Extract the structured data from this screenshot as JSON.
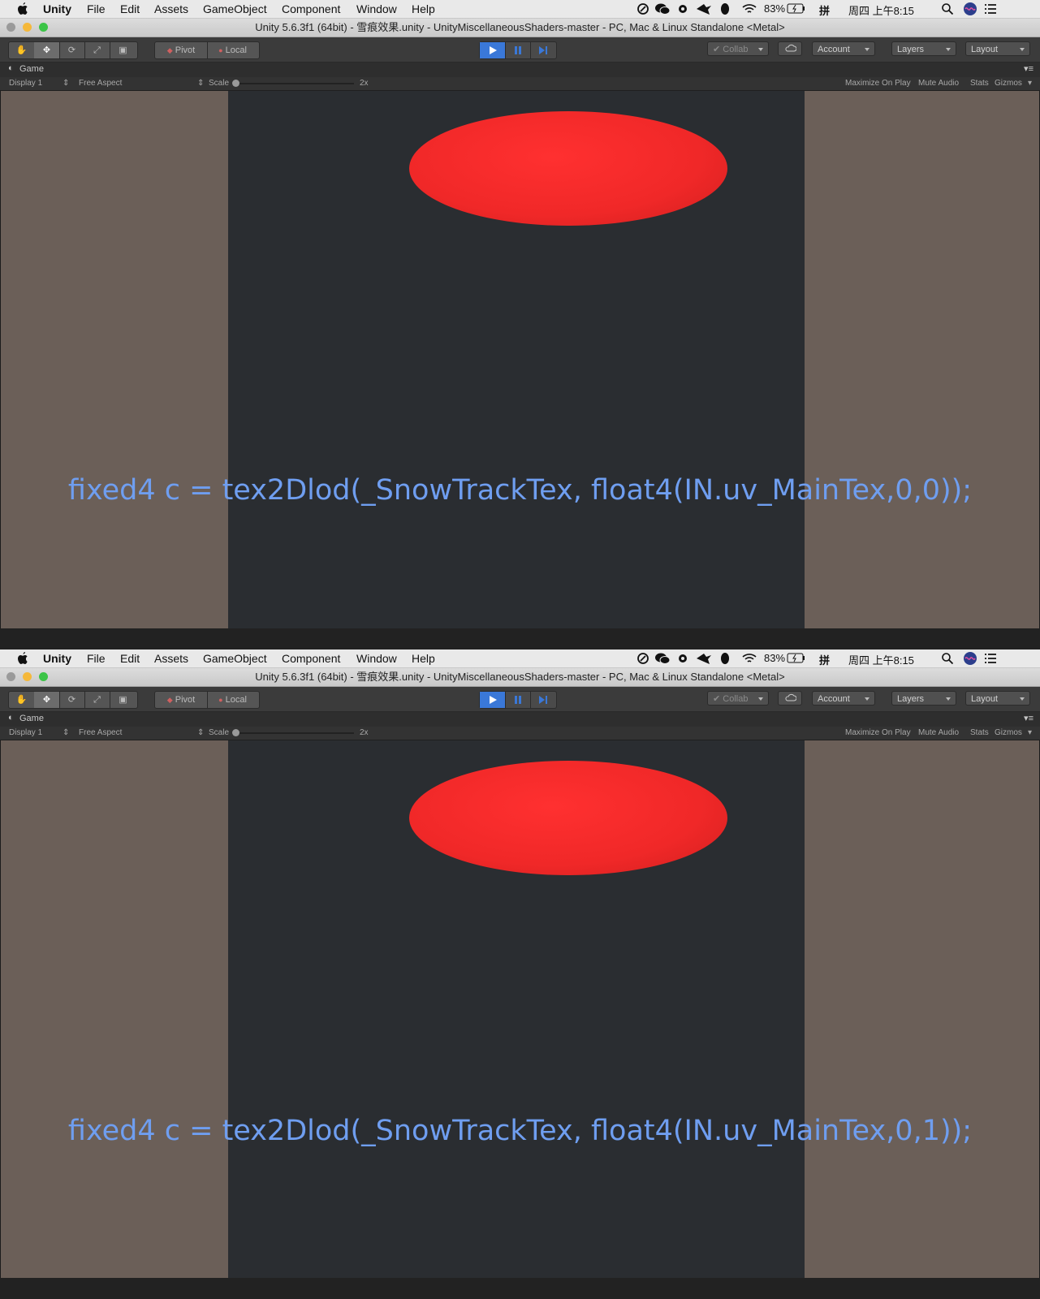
{
  "screenshots": [
    {
      "menubar": {
        "apple": "apple-logo",
        "app_name": "Unity",
        "items": [
          "File",
          "Edit",
          "Assets",
          "GameObject",
          "Component",
          "Window",
          "Help"
        ],
        "status": {
          "battery": "83%",
          "ime": "拼",
          "clock": "周四 上午8:15"
        }
      },
      "window_title": "Unity 5.6.3f1 (64bit) - 雪痕效果.unity - UnityMiscellaneousShaders-master - PC, Mac & Linux Standalone <Metal>",
      "toolbar": {
        "pivot": "Pivot",
        "local": "Local",
        "collab": "Collab",
        "account": "Account",
        "layers": "Layers",
        "layout": "Layout"
      },
      "game_tab": {
        "title": "Game",
        "display": "Display 1",
        "aspect": "Free Aspect",
        "scale_label": "Scale",
        "scale_value": "2x",
        "maximize": "Maximize On Play",
        "mute": "Mute Audio",
        "stats": "Stats",
        "gizmos": "Gizmos"
      },
      "caption": "fixed4 c = tex2Dlod(_SnowTrackTex, float4(IN.uv_MainTex,0,0));"
    },
    {
      "menubar": {
        "apple": "apple-logo",
        "app_name": "Unity",
        "items": [
          "File",
          "Edit",
          "Assets",
          "GameObject",
          "Component",
          "Window",
          "Help"
        ],
        "status": {
          "battery": "83%",
          "ime": "拼",
          "clock": "周四 上午8:15"
        }
      },
      "window_title": "Unity 5.6.3f1 (64bit) - 雪痕效果.unity - UnityMiscellaneousShaders-master - PC, Mac & Linux Standalone <Metal>",
      "toolbar": {
        "pivot": "Pivot",
        "local": "Local",
        "collab": "Collab",
        "account": "Account",
        "layers": "Layers",
        "layout": "Layout"
      },
      "game_tab": {
        "title": "Game",
        "display": "Display 1",
        "aspect": "Free Aspect",
        "scale_label": "Scale",
        "scale_value": "2x",
        "maximize": "Maximize On Play",
        "mute": "Mute Audio",
        "stats": "Stats",
        "gizmos": "Gizmos"
      },
      "caption": "fixed4 c = tex2Dlod(_SnowTrackTex, float4(IN.uv_MainTex,0,1));"
    }
  ],
  "colors": {
    "disc": "#f02828",
    "caption": "#6f9ef0",
    "scene": "#2a2d31",
    "viewport_bg": "#6b5f58",
    "play_active": "#3a78d8"
  }
}
